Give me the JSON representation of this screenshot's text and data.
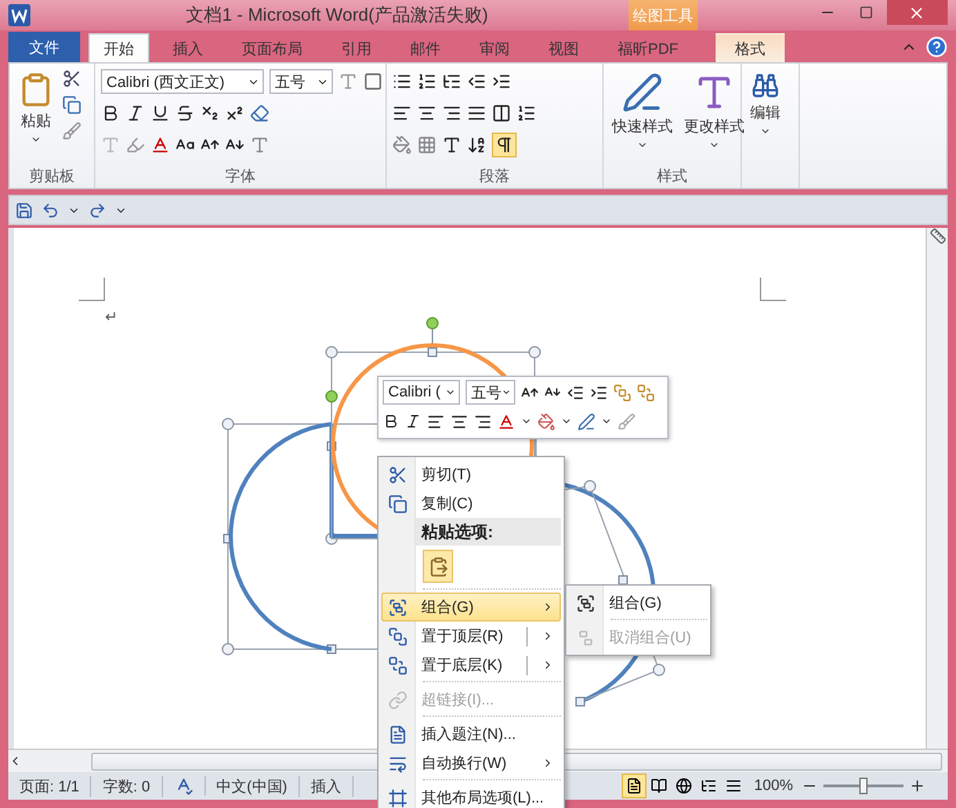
{
  "window": {
    "title": "文档1 - Microsoft Word(产品激活失败)",
    "contextual_group": "绘图工具"
  },
  "ribbon_tabs": [
    {
      "label": "文件",
      "selected": false,
      "kind": "file"
    },
    {
      "label": "开始",
      "selected": true,
      "kind": "normal"
    },
    {
      "label": "插入",
      "selected": false,
      "kind": "normal"
    },
    {
      "label": "页面布局",
      "selected": false,
      "kind": "normal"
    },
    {
      "label": "引用",
      "selected": false,
      "kind": "normal"
    },
    {
      "label": "邮件",
      "selected": false,
      "kind": "normal"
    },
    {
      "label": "审阅",
      "selected": false,
      "kind": "normal"
    },
    {
      "label": "视图",
      "selected": false,
      "kind": "normal"
    },
    {
      "label": "福昕PDF",
      "selected": false,
      "kind": "normal"
    },
    {
      "label": "格式",
      "selected": false,
      "kind": "contextual"
    }
  ],
  "ribbon_groups": {
    "clipboard": {
      "label": "剪贴板",
      "paste": "粘贴"
    },
    "font": {
      "label": "字体",
      "font_name": "Calibri (西文正文)",
      "font_size": "五号"
    },
    "paragraph": {
      "label": "段落",
      "show_marks_on": true
    },
    "styles": {
      "label": "样式",
      "buttons": [
        "快速样式",
        "更改样式"
      ]
    },
    "editing": {
      "label": "编辑"
    }
  },
  "document": {
    "paragraph_mark": "↵"
  },
  "mini_toolbar": {
    "font_name": "Calibri (",
    "font_size": "五号"
  },
  "context_menu": {
    "items": [
      {
        "kind": "item",
        "label": "剪切(T)",
        "selected": false,
        "disabled": false,
        "submenu": false,
        "split": false
      },
      {
        "kind": "item",
        "label": "复制(C)",
        "selected": false,
        "disabled": false,
        "submenu": false,
        "split": false
      },
      {
        "kind": "header",
        "label": "粘贴选项:"
      },
      {
        "kind": "paste"
      },
      {
        "kind": "item",
        "label": "组合(G)",
        "selected": true,
        "disabled": false,
        "submenu": true,
        "split": false
      },
      {
        "kind": "item",
        "label": "置于顶层(R)",
        "selected": false,
        "disabled": false,
        "submenu": true,
        "split": true
      },
      {
        "kind": "item",
        "label": "置于底层(K)",
        "selected": false,
        "disabled": false,
        "submenu": true,
        "split": true
      },
      {
        "kind": "item",
        "label": "超链接(I)...",
        "selected": false,
        "disabled": true,
        "submenu": false,
        "split": false
      },
      {
        "kind": "item",
        "label": "插入题注(N)...",
        "selected": false,
        "disabled": false,
        "submenu": false,
        "split": false
      },
      {
        "kind": "item",
        "label": "自动换行(W)",
        "selected": false,
        "disabled": false,
        "submenu": true,
        "split": false
      },
      {
        "kind": "item",
        "label": "其他布局选项(L)...",
        "selected": false,
        "disabled": false,
        "submenu": false,
        "split": false
      }
    ]
  },
  "submenu": {
    "items": [
      {
        "label": "组合(G)",
        "disabled": false
      },
      {
        "label": "取消组合(U)",
        "disabled": true
      }
    ]
  },
  "status_bar": {
    "items": [
      "页面: 1/1",
      "字数: 0"
    ],
    "language": "中文(中国)",
    "mode": "插入",
    "views": [
      {
        "selected": true
      },
      {
        "selected": false
      },
      {
        "selected": false
      },
      {
        "selected": false
      },
      {
        "selected": false
      }
    ],
    "zoom": "100%",
    "zoom_slider": {
      "level": 0.5
    }
  }
}
